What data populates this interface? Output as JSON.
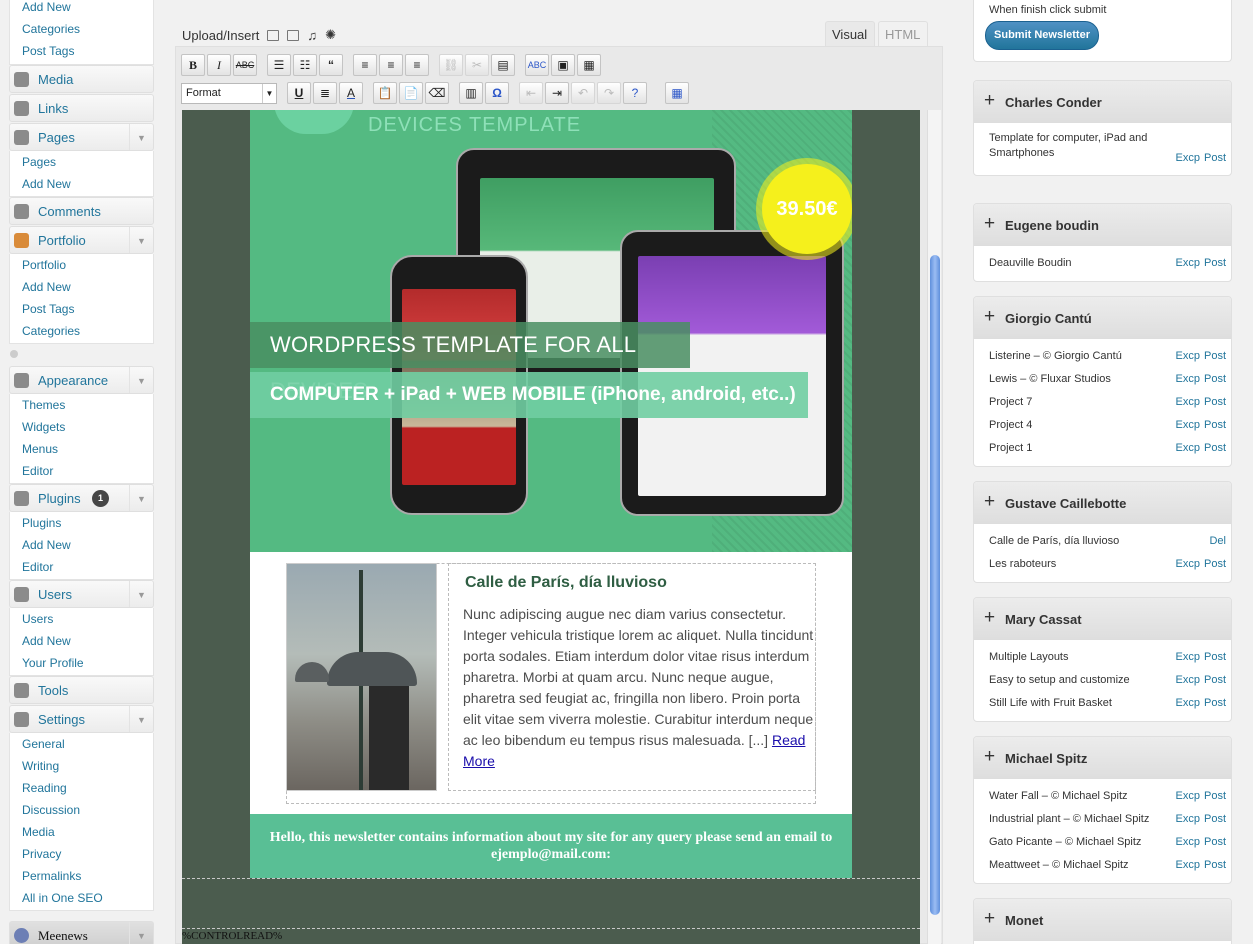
{
  "admin_menu": {
    "posts_sub": [
      "Add New",
      "Categories",
      "Post Tags"
    ],
    "media": "Media",
    "links": "Links",
    "pages": "Pages",
    "pages_sub": [
      "Pages",
      "Add New"
    ],
    "comments": "Comments",
    "portfolio": "Portfolio",
    "portfolio_sub": [
      "Portfolio",
      "Add New",
      "Post Tags",
      "Categories"
    ],
    "appearance": "Appearance",
    "appearance_sub": [
      "Themes",
      "Widgets",
      "Menus",
      "Editor"
    ],
    "plugins": "Plugins",
    "plugins_badge": "1",
    "plugins_sub": [
      "Plugins",
      "Add New",
      "Editor"
    ],
    "users": "Users",
    "users_sub": [
      "Users",
      "Add New",
      "Your Profile"
    ],
    "tools": "Tools",
    "settings": "Settings",
    "settings_sub": [
      "General",
      "Writing",
      "Reading",
      "Discussion",
      "Media",
      "Privacy",
      "Permalinks",
      "All in One SEO"
    ],
    "meenews": "Meenews"
  },
  "editor": {
    "upload_label": "Upload/Insert",
    "tab_visual": "Visual",
    "tab_html": "HTML",
    "format_label": "Format"
  },
  "newsletter": {
    "logo_text": "DEVICES TEMPLATE",
    "price": "39.50€",
    "hero_title": "WORDPRESS TEMPLATE FOR ALL DEVICES",
    "hero_subtitle": "COMPUTER + iPad + WEB MOBILE (iPhone, android, etc..)",
    "article_title": "Calle de París, día lluvioso",
    "article_body": "Nunc adipiscing augue nec diam varius consectetur. Integer vehicula tristique lorem ac aliquet. Nulla tincidunt porta sodales. Etiam interdum dolor vitae risus interdum pharetra. Morbi at quam arcu. Nunc neque augue, pharetra sed feugiat ac, fringilla non libero. Proin porta elit vitae sem viverra molestie. Curabitur interdum neque ac leo bibendum eu tempus risus malesuada. [...]",
    "read_more": "Read More",
    "footer_text": "Hello, this newsletter contains information about my site for any query please send an email to ejemplo@mail.com:",
    "control_read": "%CONTROLREAD%"
  },
  "sidebar": {
    "submit_note": "When finish click submit",
    "submit_button": "Submit Newsletter",
    "groups": [
      {
        "title": "Charles Conder",
        "items": [
          {
            "label": "Template for computer, iPad and Smartphones",
            "links": [
              "Excp",
              "Post"
            ]
          }
        ]
      },
      {
        "title": "Eugene boudin",
        "items": [
          {
            "label": "Deauville Boudin",
            "links": [
              "Excp",
              "Post"
            ]
          }
        ]
      },
      {
        "title": "Giorgio Cantú",
        "items": [
          {
            "label": "Listerine – © Giorgio Cantú",
            "links": [
              "Excp",
              "Post"
            ]
          },
          {
            "label": "Lewis – © Fluxar Studios",
            "links": [
              "Excp",
              "Post"
            ]
          },
          {
            "label": "Project 7",
            "links": [
              "Excp",
              "Post"
            ]
          },
          {
            "label": "Project 4",
            "links": [
              "Excp",
              "Post"
            ]
          },
          {
            "label": "Project 1",
            "links": [
              "Excp",
              "Post"
            ]
          }
        ]
      },
      {
        "title": "Gustave Caillebotte",
        "items": [
          {
            "label": "Calle de París, día lluvioso",
            "links": [
              "Del"
            ]
          },
          {
            "label": "Les raboteurs",
            "links": [
              "Excp",
              "Post"
            ]
          }
        ]
      },
      {
        "title": "Mary Cassat",
        "items": [
          {
            "label": "Multiple Layouts",
            "links": [
              "Excp",
              "Post"
            ]
          },
          {
            "label": "Easy to setup and customize",
            "links": [
              "Excp",
              "Post"
            ]
          },
          {
            "label": "Still Life with Fruit Basket",
            "links": [
              "Excp",
              "Post"
            ]
          }
        ]
      },
      {
        "title": "Michael Spitz",
        "items": [
          {
            "label": "Water Fall – © Michael Spitz",
            "links": [
              "Excp",
              "Post"
            ]
          },
          {
            "label": "Industrial plant – © Michael Spitz",
            "links": [
              "Excp",
              "Post"
            ]
          },
          {
            "label": "Gato Picante – © Michael Spitz",
            "links": [
              "Excp",
              "Post"
            ]
          },
          {
            "label": "Meattweet – © Michael Spitz",
            "links": [
              "Excp",
              "Post"
            ]
          }
        ]
      },
      {
        "title": "Monet",
        "items": []
      }
    ]
  },
  "colors": {
    "accent": "#21759b",
    "hero_green": "#54ba82",
    "footer_green": "#59bf95",
    "frame_bg": "#4b5c4e",
    "price_yellow": "#f5f01c"
  }
}
